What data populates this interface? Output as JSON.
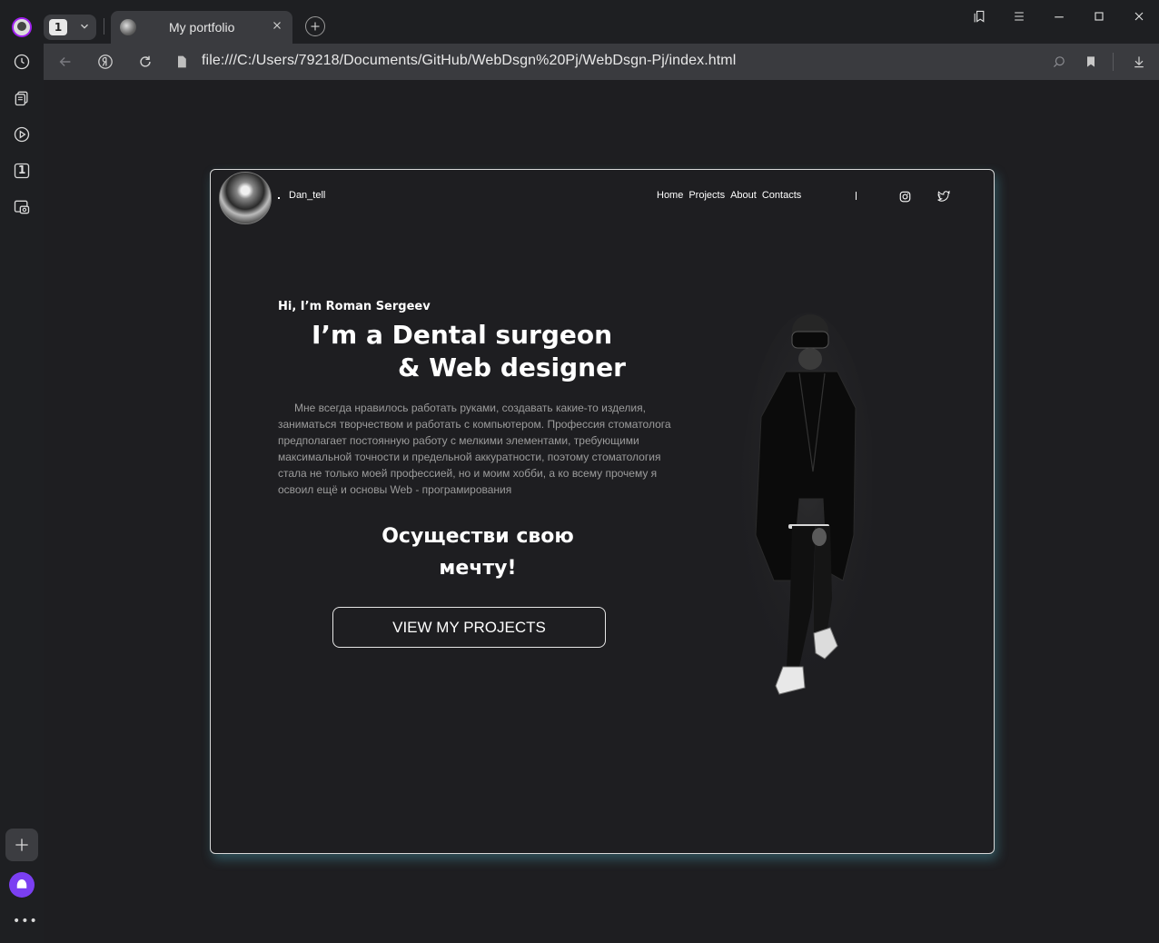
{
  "browser": {
    "tab_count": "1",
    "tab_title": "My portfolio",
    "url": "file:///C:/Users/79218/Documents/GitHub/WebDsgn%20Pj/WebDsgn-Pj/index.html",
    "accent": "#7b3ff2"
  },
  "sidebar": {
    "tabs_badge": "1"
  },
  "site": {
    "brand": "Dan_tell",
    "nav": [
      "Home",
      "Projects",
      "About",
      "Contacts"
    ],
    "nav_separator": "I",
    "greeting": "Hi, I’m Roman Sergeev",
    "headline_1": "I’m a Dental surgeon",
    "headline_2": "& Web designer",
    "paragraph": "Мне всегда нравилось работать руками, создавать какие-то изделия, заниматься творчеством и работать с компьютером. Профессия стоматолога предполагает постоянную работу с мелкими элементами, требующими максимальной точности и предельной аккуратности, поэтому стоматология стала не только моей профессией, но и моим хобби, а ко всему прочему я освоил ещё и основы Web - програмирования",
    "dream_line_1": "Осуществи свою",
    "dream_line_2": "мечту!",
    "cta": "VIEW MY PROJECTS",
    "shadow_color": "#50b4c8"
  }
}
